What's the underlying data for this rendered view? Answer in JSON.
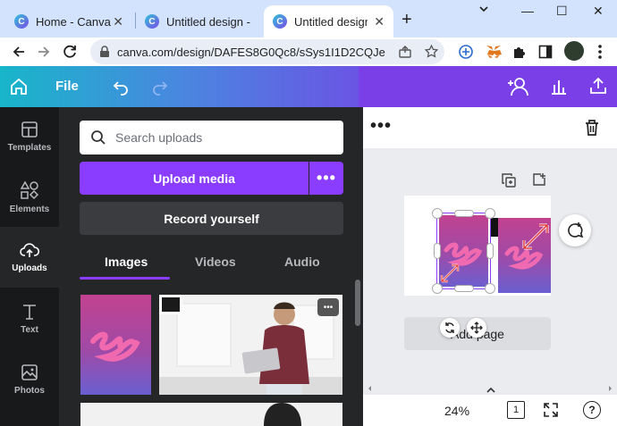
{
  "browser": {
    "tabs": [
      {
        "title": "Home - Canva"
      },
      {
        "title": "Untitled design - "
      },
      {
        "title": "Untitled design - "
      }
    ],
    "url": "canva.com/design/DAFES8G0Qc8/sSys1I1D2CQJe...",
    "new_tab": "+",
    "close_tab": "✕",
    "window_minimize": "—",
    "window_maximize": "☐",
    "window_close": "✕"
  },
  "header": {
    "file_label": "File"
  },
  "rail": {
    "items": [
      {
        "label": "Templates"
      },
      {
        "label": "Elements"
      },
      {
        "label": "Uploads"
      },
      {
        "label": "Text"
      },
      {
        "label": "Photos"
      }
    ]
  },
  "uploads": {
    "search_placeholder": "Search uploads",
    "upload_media_label": "Upload media",
    "more_label": "•••",
    "record_label": "Record yourself",
    "tabs": [
      {
        "label": "Images"
      },
      {
        "label": "Videos"
      },
      {
        "label": "Audio"
      }
    ],
    "thumb_menu": "•••"
  },
  "canvas": {
    "menu_dots": "•••",
    "add_page_label": "Add page",
    "zoom": "24%",
    "page_count": "1",
    "help": "?"
  }
}
